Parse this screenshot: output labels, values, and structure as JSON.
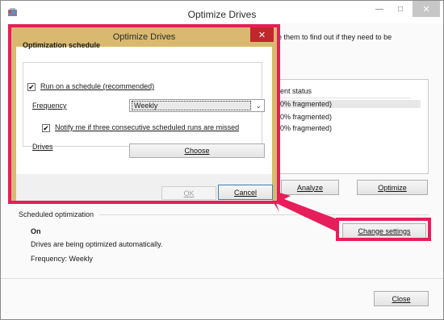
{
  "main_window": {
    "title": "Optimize Drives",
    "intro_text": "e them to find out if they need to be",
    "status_header": "ent status",
    "status_rows": [
      "0% fragmented)",
      "0% fragmented)",
      "0% fragmented)"
    ],
    "analyze_label": "Analyze",
    "optimize_label": "Optimize",
    "scheduled_label": "Scheduled optimization",
    "schedule_state": "On",
    "schedule_desc": "Drives are being optimized automatically.",
    "schedule_freq": "Frequency: Weekly",
    "change_settings_label": "Change settings",
    "close_label": "Close"
  },
  "dialog": {
    "title": "Optimize Drives",
    "heading": "Optimization schedule",
    "run_on_schedule_label": "Run on a schedule (recommended)",
    "run_on_schedule_checked": true,
    "frequency_label": "Frequency",
    "frequency_value": "Weekly",
    "notify_label": "Notify me if three consecutive scheduled runs are missed",
    "notify_checked": true,
    "drives_label": "Drives",
    "choose_label": "Choose",
    "ok_label": "OK",
    "cancel_label": "Cancel"
  },
  "icons": {
    "app": "defrag-icon",
    "minimize": "minimize-icon",
    "maximize": "maximize-icon",
    "close": "close-icon",
    "dropdown": "chevron-down-icon",
    "check": "checkmark-icon"
  },
  "colors": {
    "highlight": "#e61e5a",
    "dialog_frame": "#d9b96f",
    "dialog_close": "#c1272d"
  }
}
